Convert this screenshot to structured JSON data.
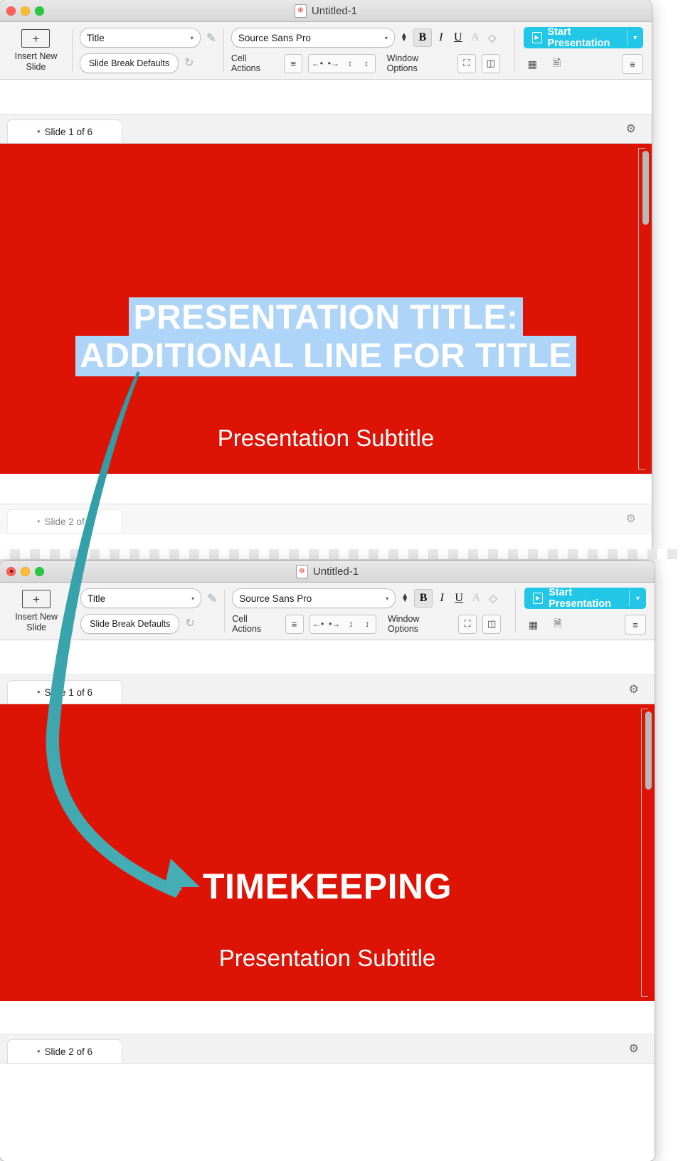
{
  "window1": {
    "title": "Untitled-1",
    "app_icon": "app-document-icon",
    "traffic_lights": [
      "close",
      "minimize",
      "zoom"
    ],
    "toolbar": {
      "insert_new_slide_label": "Insert New\nSlide",
      "insert_new_slide_line1": "Insert New",
      "insert_new_slide_line2": "Slide",
      "insert_icon": "plus-in-box-icon",
      "style_select_value": "Title",
      "style_select_caret": "▾",
      "pen_icon": "style-pen-icon",
      "slide_break_defaults_label": "Slide Break Defaults",
      "reload_icon": "reset-circular-arrow-icon",
      "font_select_value": "Source Sans Pro",
      "font_select_caret": "▾",
      "size_stepper_icon": "up-down-stepper-icon",
      "bold_label": "B",
      "italic_label": "I",
      "underline_label": "U",
      "text_color_label": "A",
      "clear_format_icon": "eraser-icon",
      "cell_actions_label": "Cell Actions",
      "cell_align_icon": "align-left-cell-icon",
      "cell_shrink_left_icon": "←•",
      "cell_grow_right_icon": "•→",
      "cell_grow_up_icon": "↕",
      "cell_grow_down_icon": "↕",
      "window_options_label": "Window Options",
      "fullscreen_icon": "expand-fullscreen-icon",
      "sidebar_icon": "toggle-sidebar-icon",
      "start_presentation_label": "Start Presentation",
      "start_presentation_play_icon": "▶",
      "start_presentation_caret": "▾",
      "grid_icon": "grid-view-icon",
      "notes_icon": "presenter-notes-icon",
      "hamburger_icon": "≡"
    },
    "slide_tab_1": {
      "bullet": "•",
      "label": "Slide 1 of  6",
      "gear_icon": "⚙"
    },
    "slide_tab_2": {
      "bullet": "•",
      "label": "Slide 2 of  6",
      "gear_icon": "⚙"
    },
    "slide": {
      "background_color": "#dd1405",
      "title_text": "PRESENTATION TITLE: ADDITIONAL LINE FOR TITLE",
      "title_line_1": "PRESENTATION TITLE:",
      "title_line_2": "ADDITIONAL LINE FOR TITLE",
      "title_highlight_color": "#aed4f7",
      "title_text_color": "#ffffff",
      "subtitle_text": "Presentation Subtitle"
    }
  },
  "window2": {
    "title": "Untitled-1",
    "app_icon": "app-document-icon",
    "traffic_lights": [
      "close",
      "minimize",
      "zoom"
    ],
    "toolbar": {
      "insert_new_slide_line1": "Insert New",
      "insert_new_slide_line2": "Slide",
      "insert_icon": "plus-in-box-icon",
      "style_select_value": "Title",
      "style_select_caret": "▾",
      "pen_icon": "style-pen-icon",
      "slide_break_defaults_label": "Slide Break Defaults",
      "reload_icon": "reset-circular-arrow-icon",
      "font_select_value": "Source Sans Pro",
      "font_select_caret": "▾",
      "bold_label": "B",
      "italic_label": "I",
      "underline_label": "U",
      "text_color_label": "A",
      "clear_format_icon": "eraser-icon",
      "cell_actions_label": "Cell Actions",
      "cell_align_icon": "align-left-cell-icon",
      "cell_shrink_left_icon": "←•",
      "cell_grow_right_icon": "•→",
      "cell_grow_up_icon": "↕",
      "cell_grow_down_icon": "↕",
      "window_options_label": "Window Options",
      "fullscreen_icon": "expand-fullscreen-icon",
      "sidebar_icon": "toggle-sidebar-icon",
      "start_presentation_label": "Start Presentation",
      "start_presentation_play_icon": "▶",
      "start_presentation_caret": "▾",
      "grid_icon": "grid-view-icon",
      "notes_icon": "presenter-notes-icon",
      "hamburger_icon": "≡"
    },
    "slide_tab_1": {
      "bullet": "•",
      "label": "Slide 1 of  6",
      "gear_icon": "⚙"
    },
    "slide_tab_2": {
      "bullet": "•",
      "label": "Slide 2 of  6",
      "gear_icon": "⚙"
    },
    "slide": {
      "background_color": "#dd1405",
      "title_text": "TIMEKEEPING",
      "title_text_color": "#ffffff",
      "subtitle_text": "Presentation Subtitle"
    }
  },
  "annotation": {
    "arrow_color": "#3aa8b0",
    "arrow_name": "curved-annotation-arrow",
    "description": "curved arrow from title of slide 1 to TIMEKEEPING title of slide 2"
  }
}
